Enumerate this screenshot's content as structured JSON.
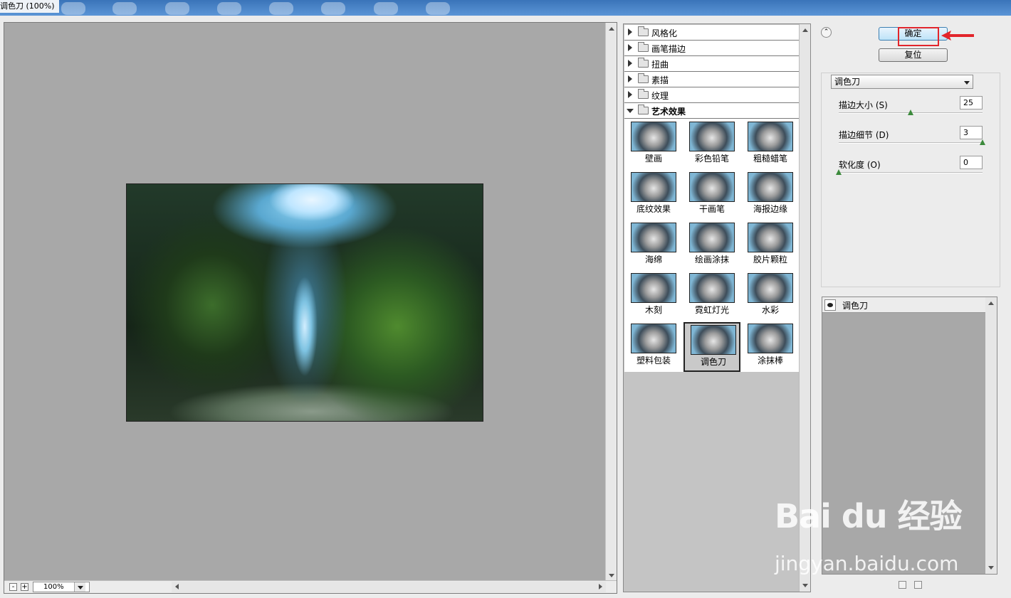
{
  "window": {
    "title": "调色刀 (100%)"
  },
  "preview": {
    "zoom": "100%",
    "zoom_out": "-",
    "zoom_in": "+"
  },
  "gallery": {
    "categories": [
      {
        "label": "风格化",
        "open": false
      },
      {
        "label": "画笔描边",
        "open": false
      },
      {
        "label": "扭曲",
        "open": false
      },
      {
        "label": "素描",
        "open": false
      },
      {
        "label": "纹理",
        "open": false
      },
      {
        "label": "艺术效果",
        "open": true
      }
    ],
    "filters": [
      "壁画",
      "彩色铅笔",
      "粗糙蜡笔",
      "底纹效果",
      "干画笔",
      "海报边缘",
      "海绵",
      "绘画涂抹",
      "胶片颗粒",
      "木刻",
      "霓虹灯光",
      "水彩",
      "塑料包装",
      "调色刀",
      "涂抹棒"
    ],
    "selected_filter": "调色刀"
  },
  "actions": {
    "ok": "确定",
    "reset": "复位",
    "collapse_icon": "double-chevron-up"
  },
  "settings": {
    "filter_select": "调色刀",
    "params": [
      {
        "label": "描边大小 (S)",
        "value": "25",
        "fraction": 0.5
      },
      {
        "label": "描边细节 (D)",
        "value": "3",
        "fraction": 1.0
      },
      {
        "label": "软化度 (O)",
        "value": "0",
        "fraction": 0.0
      }
    ]
  },
  "layers": {
    "items": [
      {
        "name": "调色刀",
        "visible": true
      }
    ]
  },
  "watermark": {
    "logo": "Bai du 经验",
    "url": "jingyan.baidu.com"
  },
  "colors": {
    "highlight": "#e2252b",
    "ok_button": "#bde3f8",
    "slider_knob": "#3c8a3c"
  }
}
